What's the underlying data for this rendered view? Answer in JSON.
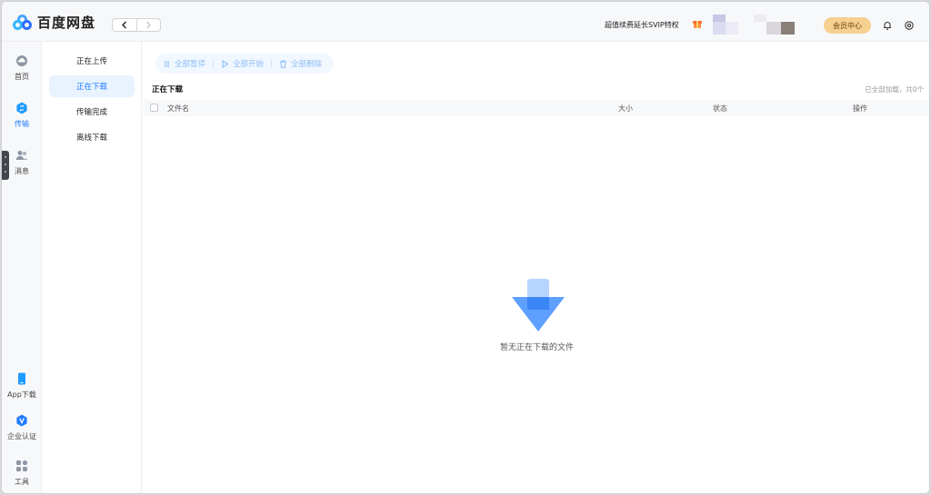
{
  "app": {
    "name": "百度网盘"
  },
  "nav": {
    "back": "‹",
    "forward": "›"
  },
  "header": {
    "promo": "超值续费延长SVIP特权",
    "vip_center": "会员中心"
  },
  "rail": {
    "home": "首页",
    "transfer": "传输",
    "messages": "消息",
    "app_download": "App下载",
    "enterprise": "企业认证",
    "tools": "工具"
  },
  "submenu": {
    "uploading": "正在上传",
    "downloading": "正在下载",
    "completed": "传输完成",
    "offline": "离线下载"
  },
  "toolbar": {
    "pause_all": "全部暂停",
    "start_all": "全部开始",
    "delete_all": "全部删除"
  },
  "main": {
    "section_title": "正在下载",
    "loaded_info": "已全部加载，共0个",
    "columns": {
      "name": "文件名",
      "size": "大小",
      "status": "状态",
      "actions": "操作"
    },
    "empty_text": "暂无正在下载的文件"
  },
  "colors": {
    "accent": "#1f7bff",
    "vip": "#f6d08e",
    "active_bg": "#e8f3ff"
  }
}
